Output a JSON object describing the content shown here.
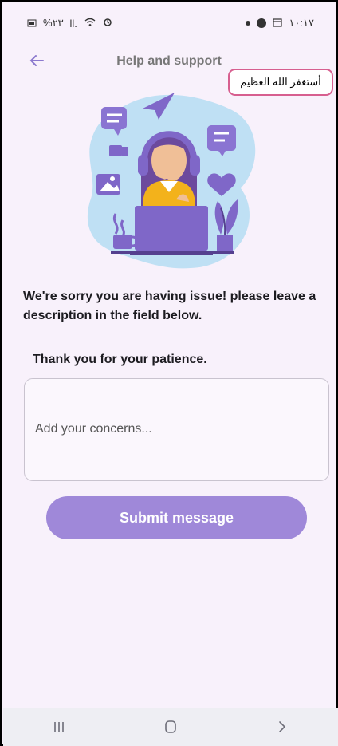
{
  "status_bar": {
    "left_text": "%٢٣",
    "signal_text": "ll.",
    "time": "١٠:١٧"
  },
  "app_bar": {
    "title": "Help and support",
    "back_icon": "arrow-left-icon"
  },
  "overlay_label": "أستغفر الله العظيم",
  "main": {
    "message": "We're sorry you are having issue! please leave a description in the field below.",
    "thanks": "Thank you for your patience.",
    "concerns_placeholder": "Add your concerns...",
    "concerns_value": "",
    "submit_label": "Submit message"
  },
  "nav_bar": {
    "items": [
      "recent-apps-icon",
      "home-icon",
      "back-icon"
    ]
  },
  "colors": {
    "accent": "#9f88d9",
    "background": "#f8f1fb",
    "overlay_border": "#d75f8f"
  }
}
